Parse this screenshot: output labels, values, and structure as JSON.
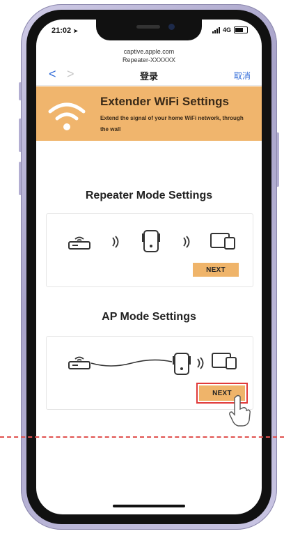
{
  "status_bar": {
    "time": "21:02",
    "network": "4G"
  },
  "browser": {
    "host": "captive.apple.com",
    "page_title": "Repeater-XXXXXX",
    "nav_title": "登录",
    "cancel_label": "取消",
    "back_label": "<",
    "forward_label": ">"
  },
  "banner": {
    "title": "Extender WiFi Settings",
    "subtitle": "Extend the signal of your home WiFi network, through the wall"
  },
  "repeater": {
    "title": "Repeater Mode Settings",
    "next_label": "NEXT"
  },
  "ap": {
    "title": "AP Mode Settings",
    "next_label": "NEXT"
  },
  "colors": {
    "banner": "#f0b56d",
    "button": "#efb46a",
    "highlight": "#e03a3a",
    "accent": "#2f6ad8"
  }
}
